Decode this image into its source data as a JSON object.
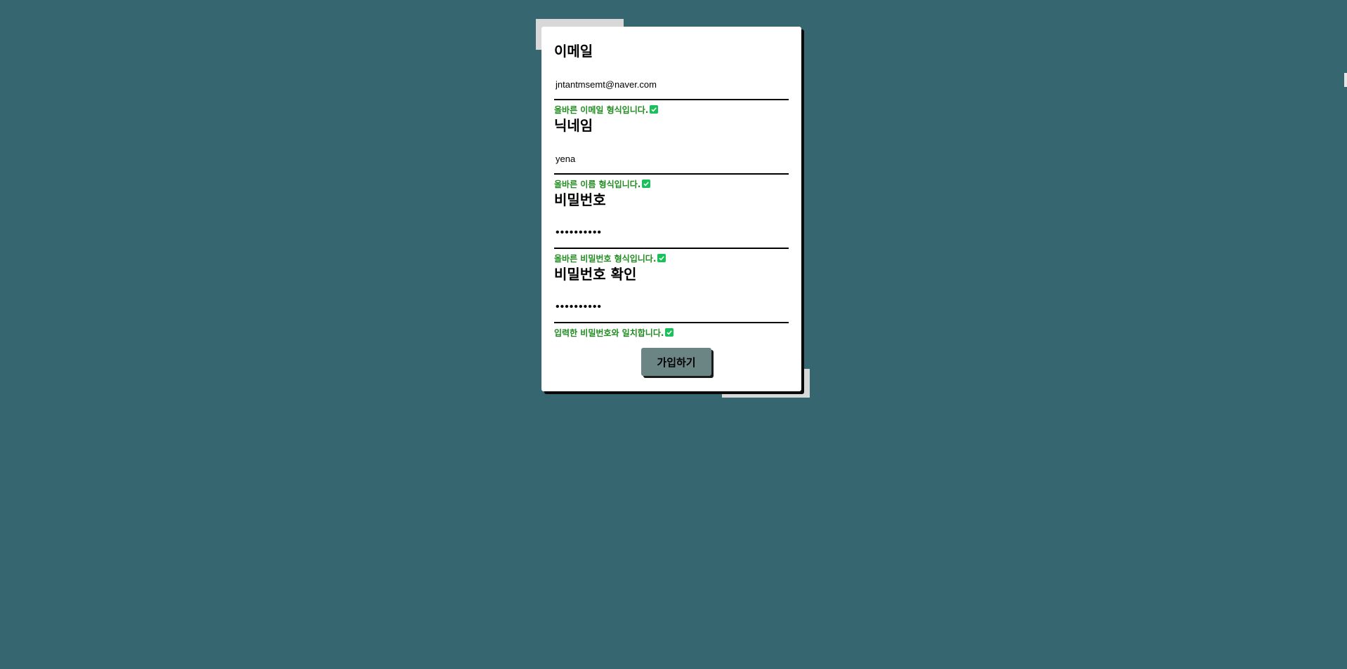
{
  "colors": {
    "background": "#366670",
    "card": "#ffffff",
    "accent_paper": "#d8d8d8",
    "valid_text": "#208c20",
    "check_icon": "#19c15a",
    "button": "#6b8585"
  },
  "form": {
    "fields": [
      {
        "label": "이메일",
        "value": "jntantmsemt@naver.com",
        "type": "text",
        "message": "올바른 이메일 형식입니다.",
        "icon": "check-icon"
      },
      {
        "label": "닉네임",
        "value": "yena",
        "type": "text",
        "message": "올바른 이름 형식입니다.",
        "icon": "check-icon"
      },
      {
        "label": "비밀번호",
        "value": "••••••••••",
        "type": "password",
        "message": "올바른 비밀번호 형식입니다.",
        "icon": "check-icon"
      },
      {
        "label": "비밀번호 확인",
        "value": "••••••••••",
        "type": "password",
        "message": "입력한 비밀번호와 일치합니다.",
        "icon": "check-icon"
      }
    ],
    "submit_label": "가입하기"
  }
}
